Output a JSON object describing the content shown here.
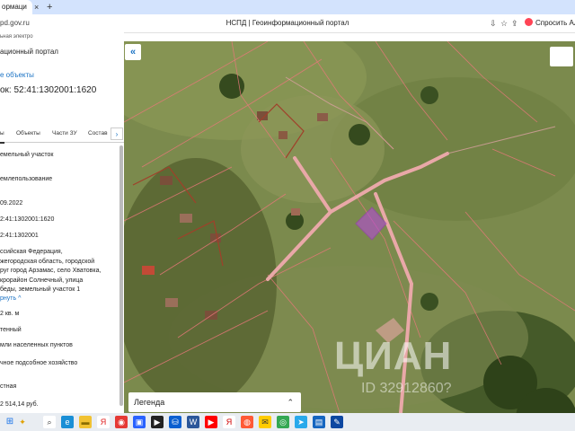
{
  "browser": {
    "tab_title": "ормаци",
    "tab_close": "×",
    "new_tab": "+",
    "url": "pd.gov.ru",
    "page_title": "НСПД | Геоинформационный портал",
    "ask_alice": "Спросить Али",
    "icons": [
      "download-icon",
      "bookmark-icon",
      "share-icon"
    ]
  },
  "panel": {
    "breadcrumb": "ьная электро",
    "portal_title": "ационный портал",
    "objects_link": "е объекты",
    "cadastral_title": "ок: 52:41:1302001:1620",
    "tabs": [
      {
        "label": "ы"
      },
      {
        "label": "Объекты"
      },
      {
        "label": "Части ЗУ"
      },
      {
        "label": "Состав"
      }
    ],
    "tabs_arrow": "›",
    "fields": {
      "type": "емельный участок",
      "usage": "емлепользование",
      "date": "09.2022",
      "cadnum": "2:41:1302001:1620",
      "quarter": "2:41:1302001",
      "address": [
        "ссийская Федерация,",
        "жегородская область, городской",
        "руг город Арзамас, село Хватовка,",
        "крорайон Солнечный, улица",
        "беды, земельный участок 1"
      ],
      "collapse": "рнуть",
      "collapse_icon": "^",
      "area": "2 кв. м",
      "status": "тенный",
      "category": "мли населенных пунктов",
      "use": "чное подсобное хозяйство",
      "ownership": "стная",
      "cost": "2 514,14 руб."
    }
  },
  "map": {
    "collapse_button": "«",
    "legend_label": "Легенда",
    "legend_chevron": "⌃⌄",
    "watermark": "ЦИАН",
    "watermark_id": "ID 32912860?"
  },
  "taskbar": {
    "start": "⊞",
    "sparkle": "✦",
    "apps": [
      {
        "name": "search-app-icon",
        "glyph": "⌕",
        "color": "#ffffff",
        "fg": "#333333"
      },
      {
        "name": "edge-app-icon",
        "glyph": "e",
        "color": "#1a8fd6",
        "fg": "#ffffff"
      },
      {
        "name": "folder-app-icon",
        "glyph": "▬",
        "color": "#f1c232",
        "fg": "#8a6d00"
      },
      {
        "name": "yandex-app-icon",
        "glyph": "Я",
        "color": "#ffffff",
        "fg": "#e02020"
      },
      {
        "name": "browser-app-icon",
        "glyph": "◉",
        "color": "#e53935",
        "fg": "#ffffff"
      },
      {
        "name": "photos-app-icon",
        "glyph": "▣",
        "color": "#2962ff",
        "fg": "#ffffff"
      },
      {
        "name": "media-app-icon",
        "glyph": "▶",
        "color": "#222222",
        "fg": "#ffffff"
      },
      {
        "name": "store-app-icon",
        "glyph": "⛁",
        "color": "#0a5fd0",
        "fg": "#ffffff"
      },
      {
        "name": "word-app-icon",
        "glyph": "W",
        "color": "#2b579a",
        "fg": "#ffffff"
      },
      {
        "name": "video-app-icon",
        "glyph": "▶",
        "color": "#ff0000",
        "fg": "#ffffff"
      },
      {
        "name": "yandex-browser-icon",
        "glyph": "Я",
        "color": "#ffffff",
        "fg": "#d00000"
      },
      {
        "name": "alice-app-icon",
        "glyph": "◍",
        "color": "#ff5a36",
        "fg": "#ffffff"
      },
      {
        "name": "mail-app-icon",
        "glyph": "✉",
        "color": "#ffcc00",
        "fg": "#333333"
      },
      {
        "name": "chrome-app-icon",
        "glyph": "◎",
        "color": "#34a853",
        "fg": "#ffffff"
      },
      {
        "name": "telegram-app-icon",
        "glyph": "➤",
        "color": "#29a9eb",
        "fg": "#ffffff"
      },
      {
        "name": "notes-app-icon",
        "glyph": "▤",
        "color": "#1565c0",
        "fg": "#ffffff"
      },
      {
        "name": "tool-app-icon",
        "glyph": "✎",
        "color": "#0d47a1",
        "fg": "#ffffff"
      }
    ]
  },
  "colors": {
    "accent": "#1b73c4",
    "parcel_highlight": "#b44ad8",
    "parcel_boundary": "#e8787a",
    "road": "#e9a8a8"
  }
}
